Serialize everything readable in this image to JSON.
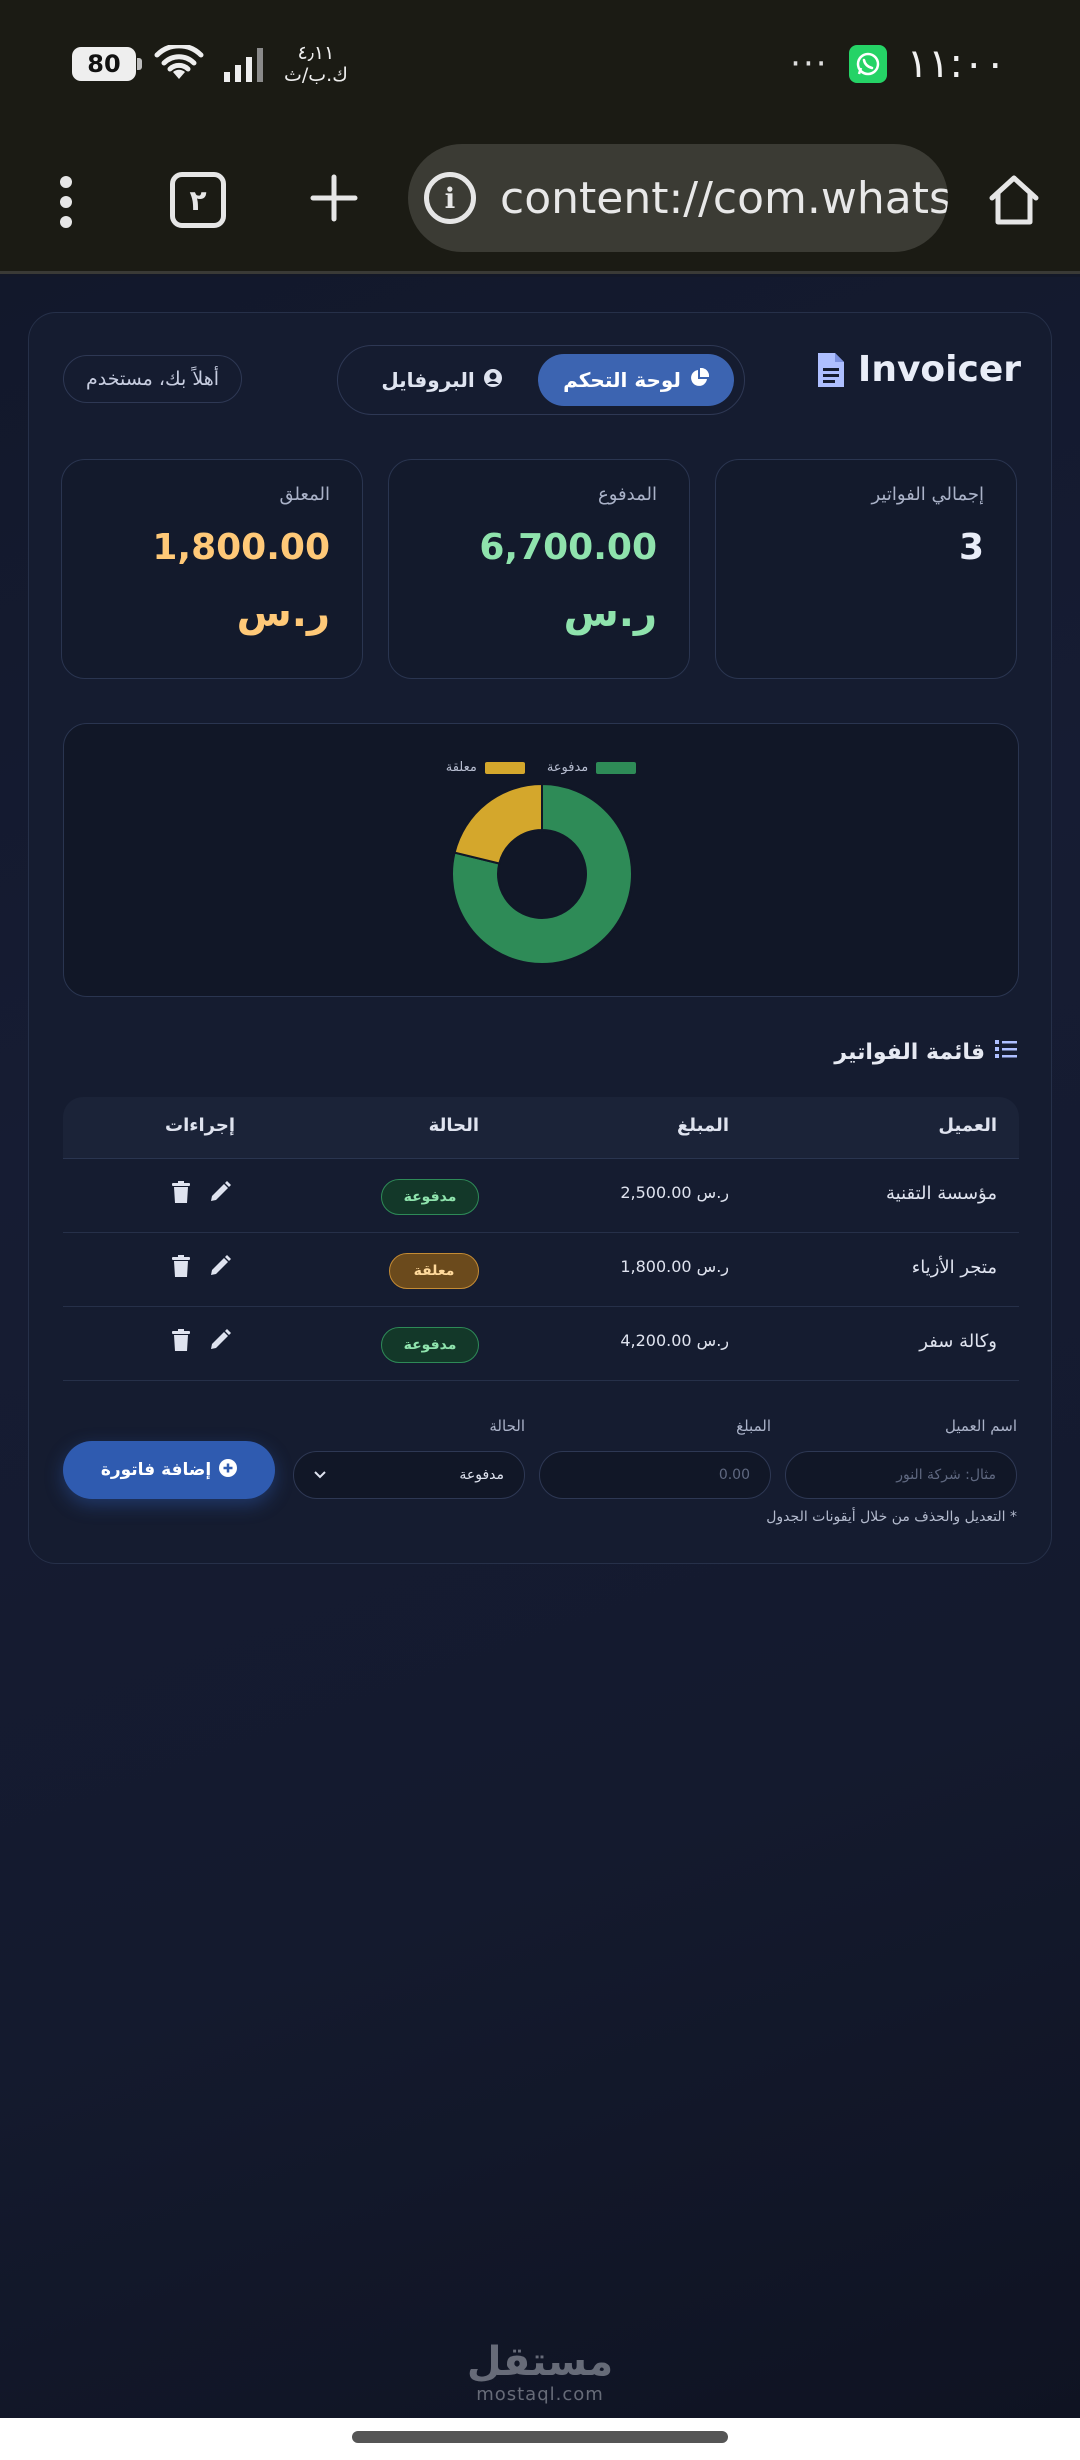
{
  "status_bar": {
    "battery": "80",
    "speed_value": "٤٫١١",
    "speed_unit": "ك.ب/ث",
    "clock": "١١:٠٠",
    "more_dots": "···"
  },
  "browser": {
    "tab_count": "٢",
    "url": "content://com.whatsa"
  },
  "app": {
    "brand": "Invoicer",
    "nav": {
      "dashboard_label": "لوحة التحكم",
      "profile_label": "البروفايل"
    },
    "greeting": "أهلاً بك، مستخدم"
  },
  "stats": {
    "total": {
      "label": "إجمالي الفواتير",
      "value": "3"
    },
    "paid": {
      "label": "المدفوع",
      "value": "6,700.00",
      "currency": "ر.س"
    },
    "pending": {
      "label": "المعلق",
      "value": "1,800.00",
      "currency": "ر.س"
    }
  },
  "chart_data": {
    "type": "pie",
    "categories": [
      "مدفوعة",
      "معلقة"
    ],
    "values": [
      6700,
      1800
    ],
    "colors": [
      "#2e8b57",
      "#d4a72c"
    ],
    "legend_position": "top"
  },
  "invoices": {
    "title": "قائمة الفواتير",
    "columns": {
      "client": "العميل",
      "amount": "المبلغ",
      "status": "الحالة",
      "actions": "إجراءات"
    },
    "rows": [
      {
        "client": "مؤسسة التقنية",
        "amount": "2,500.00 ر.س",
        "status": "مدفوعة",
        "status_type": "paid"
      },
      {
        "client": "متجر الأزياء",
        "amount": "1,800.00 ر.س",
        "status": "معلقة",
        "status_type": "pending"
      },
      {
        "client": "وكالة سفر",
        "amount": "4,200.00 ر.س",
        "status": "مدفوعة",
        "status_type": "paid"
      }
    ]
  },
  "form": {
    "client_label": "اسم العميل",
    "client_placeholder": "مثال: شركة النور",
    "amount_label": "المبلغ",
    "amount_placeholder": "0.00",
    "status_label": "الحالة",
    "status_value": "مدفوعة",
    "add_button": "إضافة فاتورة",
    "note": "* التعديل والحذف من خلال أيقونات الجدول"
  },
  "watermark": {
    "arabic": "مستقل",
    "latin": "mostaql.com"
  },
  "colors": {
    "accent": "#3c64b1",
    "paid": "#8fe3ad",
    "pending": "#ffc978"
  }
}
